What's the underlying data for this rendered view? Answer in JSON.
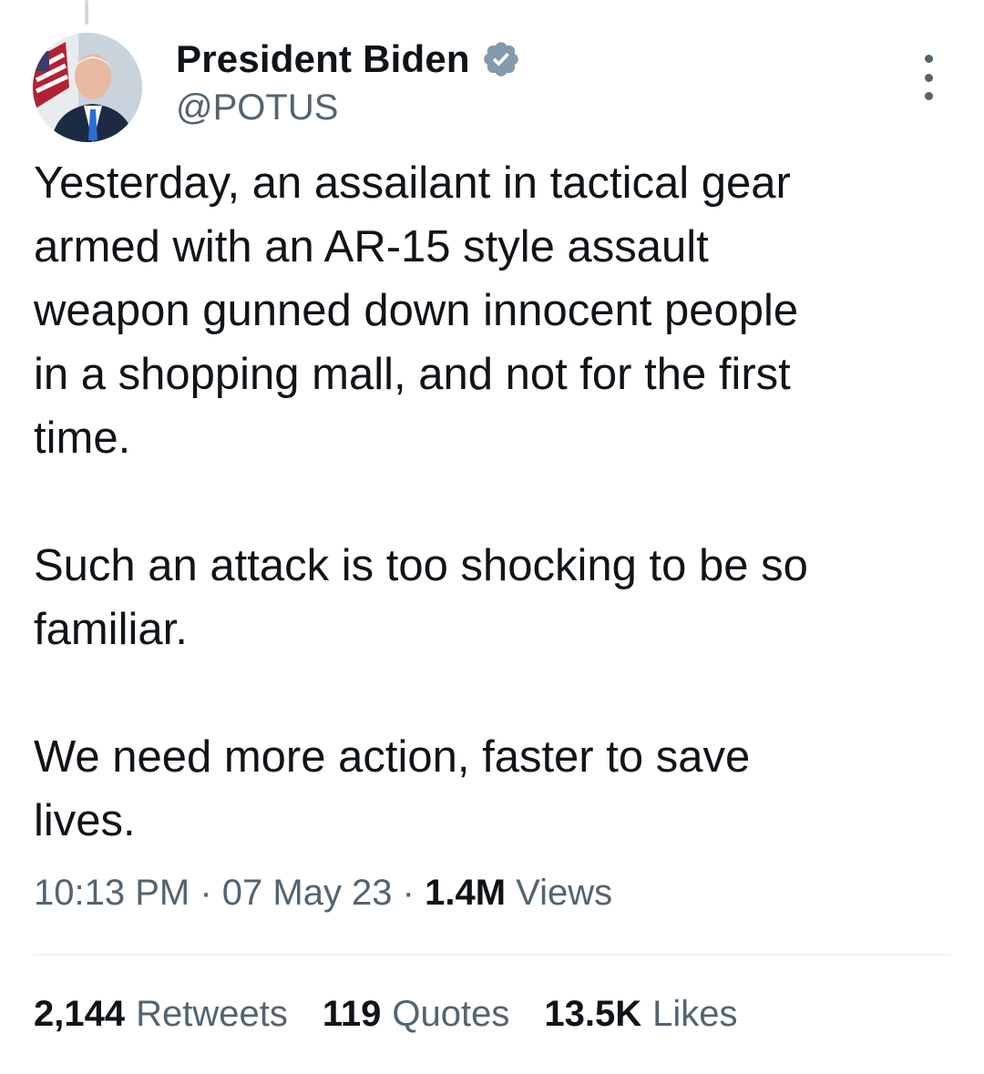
{
  "tweet": {
    "author": {
      "display_name": "President Biden",
      "handle": "@POTUS",
      "verified_icon": "verified-badge-icon",
      "avatar": "avatar-photo"
    },
    "paragraphs": [
      "Yesterday, an assailant in tactical gear\narmed with an AR-15 style assault\nweapon gunned down innocent people\nin a shopping mall, and not for the first\ntime.",
      "Such an attack is too shocking to be so\nfamiliar.",
      "We need more action, faster to save\nlives."
    ],
    "meta": {
      "time": "10:13 PM",
      "sep1": " · ",
      "date": "07 May 23",
      "sep2": " · ",
      "views_count": "1.4M",
      "views_label": "Views"
    },
    "stats": {
      "retweets_count": "2,144",
      "retweets_label": "Retweets",
      "quotes_count": "119",
      "quotes_label": "Quotes",
      "likes_count": "13.5K",
      "likes_label": "Likes"
    }
  },
  "colors": {
    "text_primary": "#0f1419",
    "text_secondary": "#536471",
    "divider": "#eff3f4",
    "verified_badge": "#829aab"
  }
}
